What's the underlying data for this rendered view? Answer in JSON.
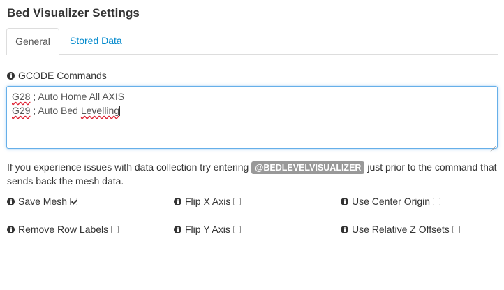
{
  "page": {
    "title": "Bed Visualizer Settings"
  },
  "tabs": [
    {
      "label": "General",
      "active": true
    },
    {
      "label": "Stored Data",
      "active": false
    }
  ],
  "gcode": {
    "label": "GCODE Commands",
    "lines": [
      {
        "code": "G28",
        "comment": " ; Auto Home All AXIS"
      },
      {
        "code": "G29",
        "comment": " ; Auto Bed ",
        "last_word": "Levelling"
      }
    ]
  },
  "help": {
    "before": "If you experience issues with data collection try entering ",
    "badge": "@BEDLEVELVISUALIZER",
    "after": " just prior to the command that sends back the mesh data."
  },
  "options": {
    "save_mesh": {
      "label": "Save Mesh",
      "checked": true
    },
    "flip_x": {
      "label": "Flip X Axis",
      "checked": false
    },
    "center_origin": {
      "label": "Use Center Origin",
      "checked": false
    },
    "remove_row_labels": {
      "label": "Remove Row Labels",
      "checked": false
    },
    "flip_y": {
      "label": "Flip Y Axis",
      "checked": false
    },
    "relative_z": {
      "label": "Use Relative Z Offsets",
      "checked": false
    }
  },
  "colors": {
    "link": "#0088cc",
    "focus_border": "#66afe9",
    "badge_bg": "#999999"
  }
}
